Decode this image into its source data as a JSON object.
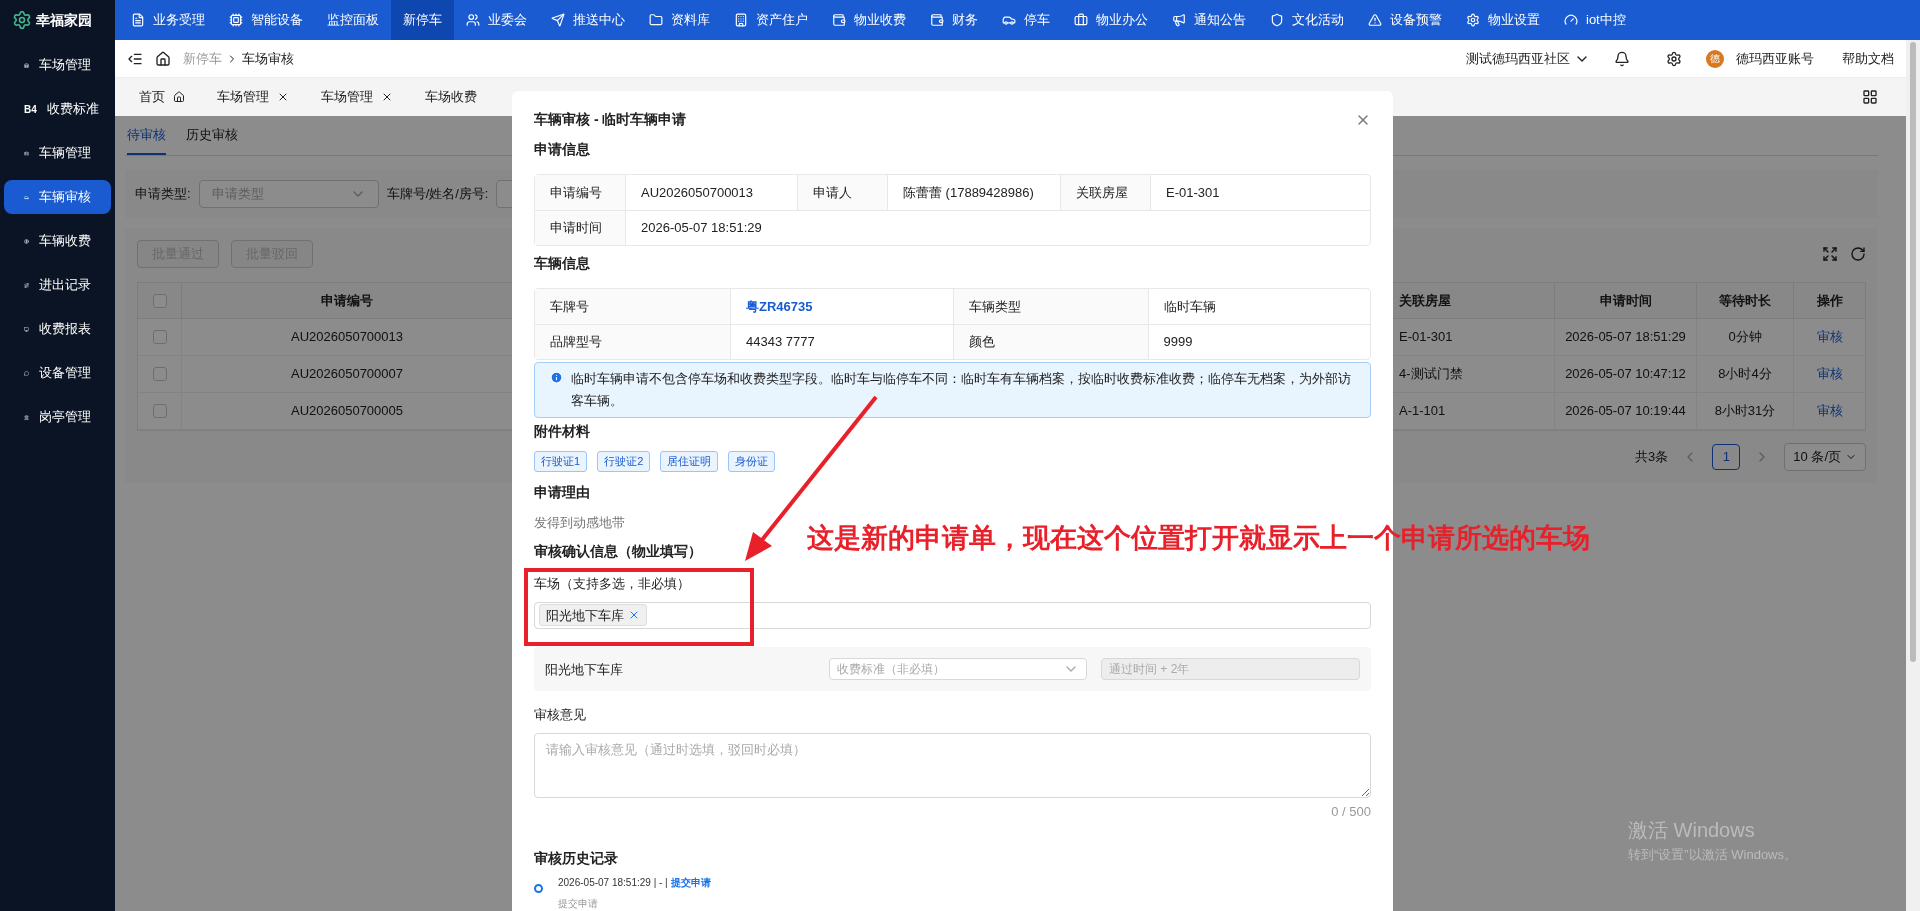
{
  "app": {
    "name": "幸福家园"
  },
  "top_nav": [
    {
      "label": "业务受理",
      "icon": true,
      "selected": false
    },
    {
      "label": "智能设备",
      "icon": true,
      "selected": false
    },
    {
      "label": "监控面板",
      "icon": false,
      "selected": false
    },
    {
      "label": "新停车",
      "icon": false,
      "selected": true
    },
    {
      "label": "业委会",
      "icon": true,
      "selected": false
    },
    {
      "label": "推送中心",
      "icon": true,
      "selected": false
    },
    {
      "label": "资料库",
      "icon": true,
      "selected": false
    },
    {
      "label": "资产住户",
      "icon": true,
      "selected": false
    },
    {
      "label": "物业收费",
      "icon": true,
      "selected": false
    },
    {
      "label": "财务",
      "icon": true,
      "selected": false
    },
    {
      "label": "停车",
      "icon": true,
      "selected": false
    },
    {
      "label": "物业办公",
      "icon": true,
      "selected": false
    },
    {
      "label": "通知公告",
      "icon": true,
      "selected": false
    },
    {
      "label": "文化活动",
      "icon": true,
      "selected": false
    },
    {
      "label": "设备预警",
      "icon": true,
      "selected": false
    },
    {
      "label": "物业设置",
      "icon": true,
      "selected": false
    },
    {
      "label": "iot中控",
      "icon": true,
      "selected": false
    }
  ],
  "sidebar": {
    "items": [
      {
        "label": "车场管理",
        "selected": false
      },
      {
        "label": "收费标准",
        "icon_text": "B4",
        "selected": false
      },
      {
        "label": "车辆管理",
        "selected": false
      },
      {
        "label": "车辆审核",
        "selected": true
      },
      {
        "label": "车辆收费",
        "selected": false
      },
      {
        "label": "进出记录",
        "selected": false
      },
      {
        "label": "收费报表",
        "selected": false
      },
      {
        "label": "设备管理",
        "selected": false
      },
      {
        "label": "岗亭管理",
        "selected": false
      }
    ]
  },
  "header": {
    "breadcrumb": [
      "新停车",
      "车场审核"
    ],
    "community": "测试德玛西亚社区",
    "avatar": "德",
    "account": "德玛西亚账号",
    "help": "帮助文档"
  },
  "page_tabs": [
    {
      "label": "首页",
      "kind": "home",
      "selected": false
    },
    {
      "label": "车场管理",
      "kind": "page",
      "selected": false
    },
    {
      "label": "车场管理",
      "kind": "page",
      "selected": false
    },
    {
      "label": "车场收费",
      "kind": "cut",
      "selected": false
    }
  ],
  "sub_tabs": [
    {
      "label": "待审核",
      "selected": true
    },
    {
      "label": "历史审核",
      "selected": false
    }
  ],
  "filters": [
    {
      "label": "申请类型:",
      "kind": "select",
      "placeholder": "申请类型"
    },
    {
      "label": "车牌号/姓名/房号:",
      "kind": "input"
    }
  ],
  "batch_buttons": [
    {
      "label": "批量通过",
      "disabled": true
    },
    {
      "label": "批量驳回",
      "disabled": true
    }
  ],
  "table": {
    "all_checked": false,
    "columns": [
      "申请编号",
      "关联房屋",
      "申请时间",
      "等待时长",
      "操作"
    ],
    "rows": [
      {
        "checked": false,
        "cells": [
          "AU2026050700013",
          "E-01-301",
          "2026-05-07 18:51:29",
          "0分钟",
          "审核"
        ]
      },
      {
        "checked": false,
        "cells": [
          "AU2026050700007",
          "4-测试门禁",
          "2026-05-07 10:47:12",
          "8小时4分",
          "审核"
        ]
      },
      {
        "checked": false,
        "cells": [
          "AU2026050700005",
          "A-1-101",
          "2026-05-07 10:19:44",
          "8小时31分",
          "审核"
        ]
      }
    ]
  },
  "pagination": {
    "total": "共3条",
    "pages": [
      {
        "label": "1",
        "selected": true
      }
    ],
    "page_size": "10 条/页"
  },
  "modal": {
    "title": "车辆审核 - 临时车辆申请",
    "application": {
      "title": "申请信息",
      "rows": [
        [
          {
            "label": "申请编号",
            "value": "AU2026050700013"
          },
          {
            "label": "申请人",
            "value": "陈蕾蕾 (17889428986)"
          },
          {
            "label": "关联房屋",
            "value": "E-01-301"
          }
        ],
        [
          {
            "label": "申请时间",
            "value": "2026-05-07 18:51:29"
          }
        ]
      ]
    },
    "vehicle": {
      "title": "车辆信息",
      "rows": [
        [
          {
            "label": "车牌号",
            "value": "粤ZR46735",
            "link": true
          },
          {
            "label": "车辆类型",
            "value": "临时车辆",
            "link": false
          }
        ],
        [
          {
            "label": "品牌型号",
            "value": "44343 7777",
            "link": false
          },
          {
            "label": "颜色",
            "value": "9999",
            "link": false
          }
        ]
      ]
    },
    "notice": "临时车辆申请不包含停车场和收费类型字段。临时车与临停车不同：临时车有车辆档案，按临时收费标准收费；临停车无档案，为外部访客车辆。",
    "attachments": {
      "title": "附件材料",
      "tags": [
        "行驶证1",
        "行驶证2",
        "居住证明",
        "身份证"
      ]
    },
    "reason": {
      "title": "申请理由",
      "text": "发得到动感地带"
    },
    "review": {
      "title": "审核确认信息（物业填写）",
      "lot_label": "车场（支持多选，非必填）",
      "lots": [
        "阳光地下车库"
      ],
      "lot_rows": [
        {
          "name": "阳光地下车库",
          "fee_placeholder": "收费标准（非必填）",
          "time_placeholder": "通过时间 + 2年"
        }
      ],
      "opinion_label": "审核意见",
      "opinion_placeholder": "请输入审核意见（通过时选填，驳回时必填）",
      "counter": "0 / 500"
    },
    "history": {
      "title": "审核历史记录",
      "items": [
        {
          "meta": "2026-05-07 18:51:29 | - | ",
          "action": "提交申请",
          "note": "提交申请"
        }
      ]
    }
  },
  "annotation": {
    "text": "这是新的申请单，现在这个位置打开就显示上一个申请所选的车场"
  },
  "os_overlay": {
    "title": "激活 Windows",
    "subtitle": "转到“设置”以激活 Windows。"
  }
}
